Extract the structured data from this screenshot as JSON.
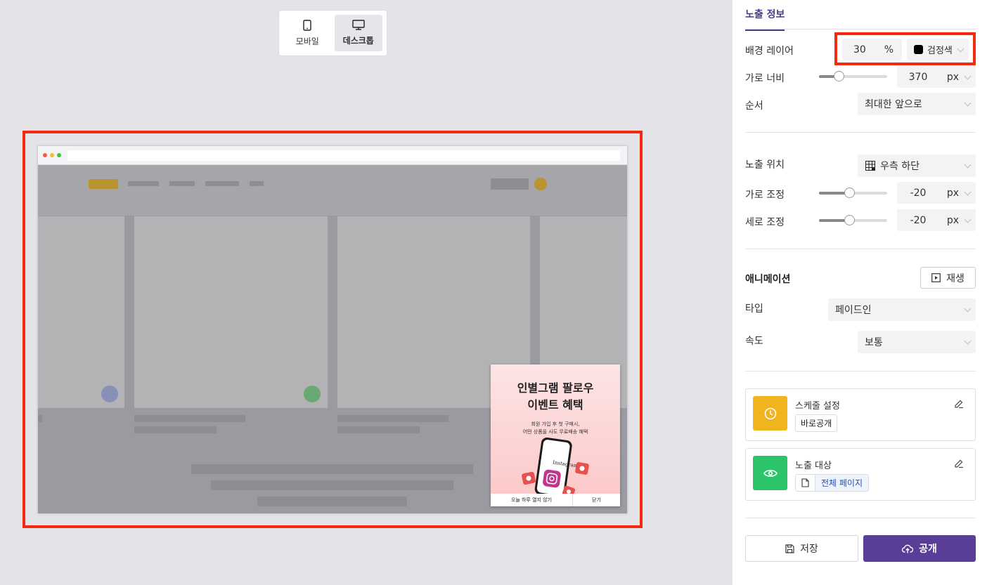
{
  "device_toggle": {
    "mobile_label": "모바일",
    "desktop_label": "데스크톱",
    "active": "desktop"
  },
  "popup": {
    "title_line1": "인별그램 팔로우",
    "title_line2": "이벤트 혜택",
    "sub_line1": "회원 가입 후 첫 구매시,",
    "sub_line2": "어떤 상품을 사도 무료배송 혜택",
    "dont_show_today": "오늘 하루 열지 않기",
    "close": "닫기",
    "phone_brand": "Instagram"
  },
  "panel": {
    "tab_title": "노출 정보",
    "background_layer": {
      "label": "배경 레이어",
      "value": "30",
      "unit": "%",
      "color_label": "검정색",
      "color": "#000000"
    },
    "width": {
      "label": "가로 너비",
      "value": "370",
      "unit": "px",
      "slider_fraction": 0.3
    },
    "order": {
      "label": "순서",
      "value": "최대한 앞으로"
    },
    "position": {
      "label": "노출 위치",
      "value": "우측 하단"
    },
    "h_offset": {
      "label": "가로 조정",
      "value": "-20",
      "unit": "px",
      "slider_fraction": 0.45
    },
    "v_offset": {
      "label": "세로 조정",
      "value": "-20",
      "unit": "px",
      "slider_fraction": 0.45
    },
    "animation": {
      "label": "애니메이션",
      "play_label": "재생"
    },
    "type": {
      "label": "타입",
      "value": "페이드인"
    },
    "speed": {
      "label": "속도",
      "value": "보통"
    },
    "schedule": {
      "title": "스케줄 설정",
      "tag": "바로공개",
      "color": "#f0b41e"
    },
    "target": {
      "title": "노출 대상",
      "tag": "전체 페이지",
      "color": "#2cc46a"
    },
    "save_label": "저장",
    "publish_label": "공개"
  },
  "colors": {
    "accent": "#5a3d96",
    "highlight": "#f22a10"
  }
}
